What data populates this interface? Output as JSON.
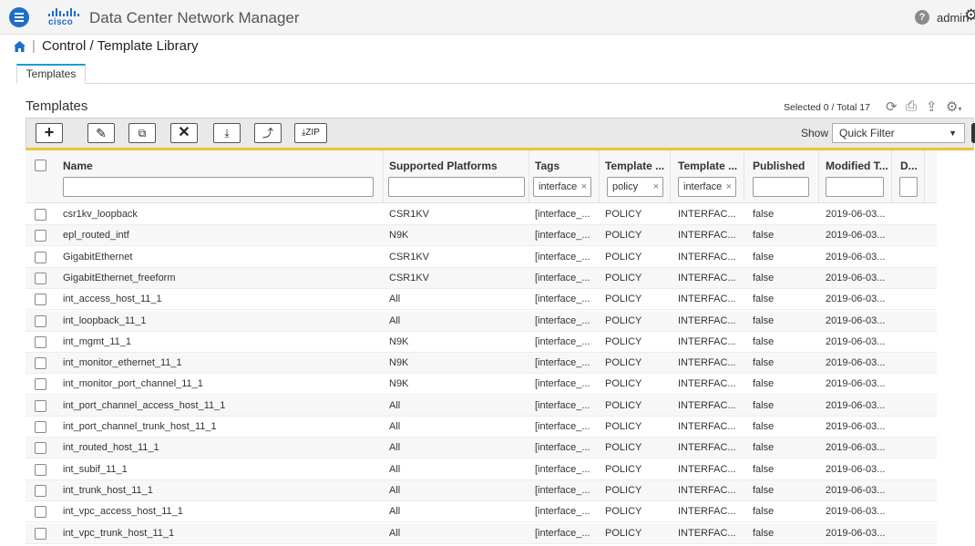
{
  "app": {
    "title": "Data Center Network Manager",
    "logo_text": "cisco",
    "user": "admin"
  },
  "breadcrumb": {
    "title": "Control / Template Library"
  },
  "tabs": [
    {
      "label": "Templates",
      "active": true
    }
  ],
  "section": {
    "title": "Templates",
    "selection_status": "Selected 0 / Total 17"
  },
  "toolbar": {
    "zip_label": "ZIP",
    "show_label": "Show",
    "filter_value": "Quick Filter"
  },
  "table": {
    "columns": [
      {
        "label": "Name",
        "filter": ""
      },
      {
        "label": "Supported Platforms",
        "filter": ""
      },
      {
        "label": "Tags",
        "filter": "interface"
      },
      {
        "label": "Template ...",
        "filter": "policy"
      },
      {
        "label": "Template ...",
        "filter": "interface"
      },
      {
        "label": "Published",
        "filter": ""
      },
      {
        "label": "Modified T...",
        "filter": ""
      },
      {
        "label": "D...",
        "filter": ""
      }
    ],
    "rows": [
      {
        "name": "csr1kv_loopback",
        "platforms": "CSR1KV",
        "tags": "[interface_...",
        "type": "POLICY",
        "subtype": "INTERFAC...",
        "published": "false",
        "modified": "2019-06-03..."
      },
      {
        "name": "epl_routed_intf",
        "platforms": "N9K",
        "tags": "[interface_...",
        "type": "POLICY",
        "subtype": "INTERFAC...",
        "published": "false",
        "modified": "2019-06-03..."
      },
      {
        "name": "GigabitEthernet",
        "platforms": "CSR1KV",
        "tags": "[interface_...",
        "type": "POLICY",
        "subtype": "INTERFAC...",
        "published": "false",
        "modified": "2019-06-03..."
      },
      {
        "name": "GigabitEthernet_freeform",
        "platforms": "CSR1KV",
        "tags": "[interface_...",
        "type": "POLICY",
        "subtype": "INTERFAC...",
        "published": "false",
        "modified": "2019-06-03..."
      },
      {
        "name": "int_access_host_11_1",
        "platforms": "All",
        "tags": "[interface_...",
        "type": "POLICY",
        "subtype": "INTERFAC...",
        "published": "false",
        "modified": "2019-06-03..."
      },
      {
        "name": "int_loopback_11_1",
        "platforms": "All",
        "tags": "[interface_...",
        "type": "POLICY",
        "subtype": "INTERFAC...",
        "published": "false",
        "modified": "2019-06-03..."
      },
      {
        "name": "int_mgmt_11_1",
        "platforms": "N9K",
        "tags": "[interface_...",
        "type": "POLICY",
        "subtype": "INTERFAC...",
        "published": "false",
        "modified": "2019-06-03..."
      },
      {
        "name": "int_monitor_ethernet_11_1",
        "platforms": "N9K",
        "tags": "[interface_...",
        "type": "POLICY",
        "subtype": "INTERFAC...",
        "published": "false",
        "modified": "2019-06-03..."
      },
      {
        "name": "int_monitor_port_channel_11_1",
        "platforms": "N9K",
        "tags": "[interface_...",
        "type": "POLICY",
        "subtype": "INTERFAC...",
        "published": "false",
        "modified": "2019-06-03..."
      },
      {
        "name": "int_port_channel_access_host_11_1",
        "platforms": "All",
        "tags": "[interface_...",
        "type": "POLICY",
        "subtype": "INTERFAC...",
        "published": "false",
        "modified": "2019-06-03..."
      },
      {
        "name": "int_port_channel_trunk_host_11_1",
        "platforms": "All",
        "tags": "[interface_...",
        "type": "POLICY",
        "subtype": "INTERFAC...",
        "published": "false",
        "modified": "2019-06-03..."
      },
      {
        "name": "int_routed_host_11_1",
        "platforms": "All",
        "tags": "[interface_...",
        "type": "POLICY",
        "subtype": "INTERFAC...",
        "published": "false",
        "modified": "2019-06-03..."
      },
      {
        "name": "int_subif_11_1",
        "platforms": "All",
        "tags": "[interface_...",
        "type": "POLICY",
        "subtype": "INTERFAC...",
        "published": "false",
        "modified": "2019-06-03..."
      },
      {
        "name": "int_trunk_host_11_1",
        "platforms": "All",
        "tags": "[interface_...",
        "type": "POLICY",
        "subtype": "INTERFAC...",
        "published": "false",
        "modified": "2019-06-03..."
      },
      {
        "name": "int_vpc_access_host_11_1",
        "platforms": "All",
        "tags": "[interface_...",
        "type": "POLICY",
        "subtype": "INTERFAC...",
        "published": "false",
        "modified": "2019-06-03..."
      },
      {
        "name": "int_vpc_trunk_host_11_1",
        "platforms": "All",
        "tags": "[interface_...",
        "type": "POLICY",
        "subtype": "INTERFAC...",
        "published": "false",
        "modified": "2019-06-03..."
      }
    ]
  },
  "colors": {
    "accent": "#1e6ec8",
    "tab_accent": "#1e9bd7",
    "toolbar_highlight": "#f2c233"
  }
}
